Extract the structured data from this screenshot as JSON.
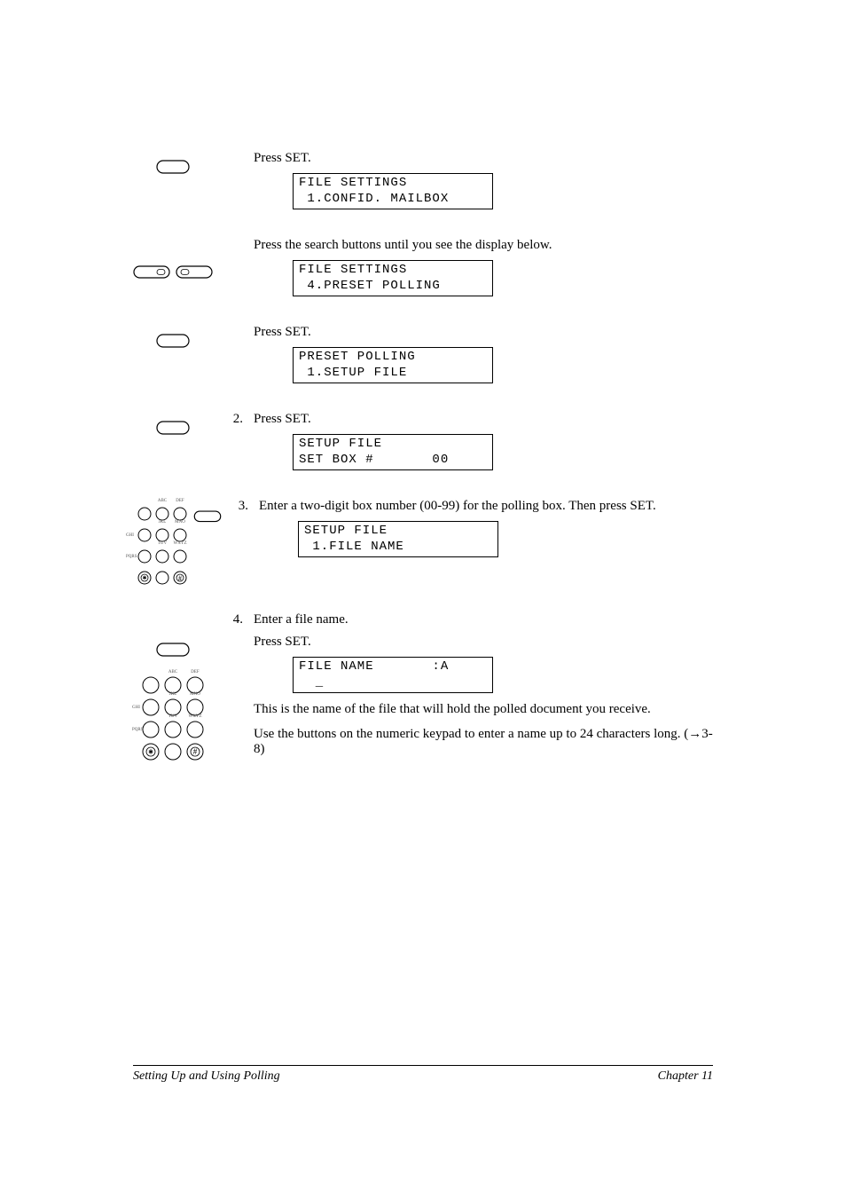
{
  "steps": [
    {
      "num": "",
      "instruction": "Press SET.",
      "lcd": "FILE SETTINGS\n 1.CONFID. MAILBOX",
      "icon": "set"
    },
    {
      "num": "",
      "instruction": "Press the search buttons until you see the display below.",
      "lcd": "FILE SETTINGS\n 4.PRESET POLLING",
      "icon": "search"
    },
    {
      "num": "",
      "instruction": "Press SET.",
      "lcd": "PRESET POLLING\n 1.SETUP FILE",
      "icon": "set"
    },
    {
      "num": "2.",
      "instruction": "Press SET.",
      "lcd": "SETUP FILE\nSET BOX #       00",
      "icon": "set"
    },
    {
      "num": "3.",
      "instruction": "Enter a two-digit box number (00-99) for the polling box. Then press SET.",
      "lcd": "SETUP FILE\n 1.FILE NAME",
      "icon": "keypad-set"
    },
    {
      "num": "4.",
      "instruction": "Enter a file name.",
      "instruction2": "Press SET.",
      "lcd": "FILE NAME       :A\n  _",
      "followup1": "This is the name of the file that will hold the polled document you receive.",
      "followup2a": "Use the buttons on the numeric keypad to enter a name up to 24 characters long. (",
      "followup2arrow": "→",
      "followup2b": "3-8)",
      "icon": "set-then-keypad"
    }
  ],
  "footer_left": "Setting Up and Using Polling",
  "footer_right": "Chapter 11",
  "keypad_labels": [
    "",
    "ABC",
    "DEF",
    "GHI",
    "JKL",
    "MNO",
    "PQRS",
    "TUV",
    "WXYZ",
    "",
    "",
    ""
  ],
  "keypad_symbols": {
    "star": "✱",
    "hash": "#"
  }
}
